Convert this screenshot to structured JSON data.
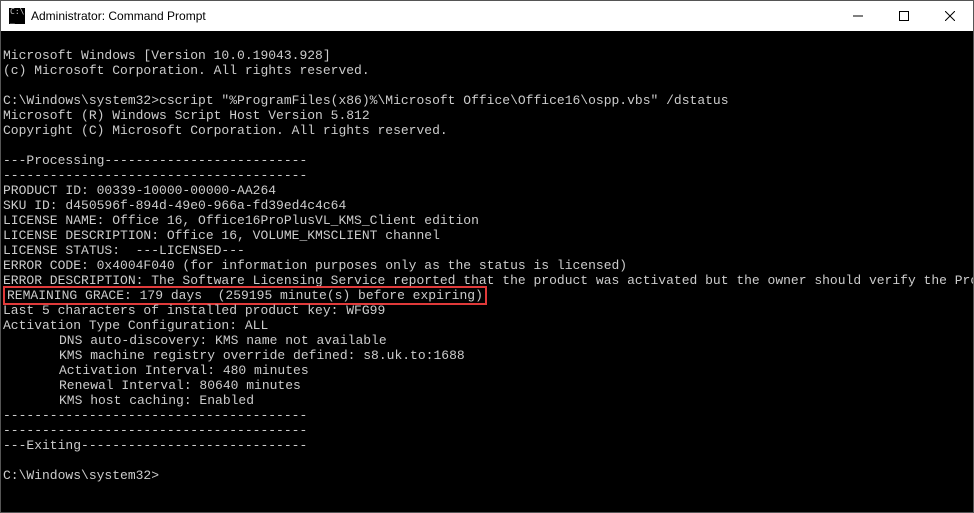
{
  "window": {
    "title": "Administrator: Command Prompt"
  },
  "terminal": {
    "header1": "Microsoft Windows [Version 10.0.19043.928]",
    "header2": "(c) Microsoft Corporation. All rights reserved.",
    "prompt1": "C:\\Windows\\system32>cscript \"%ProgramFiles(x86)%\\Microsoft Office\\Office16\\ospp.vbs\" /dstatus",
    "scripthost1": "Microsoft (R) Windows Script Host Version 5.812",
    "scripthost2": "Copyright (C) Microsoft Corporation. All rights reserved.",
    "processing": "---Processing--------------------------",
    "sep": "---------------------------------------",
    "product_id": "PRODUCT ID: 00339-10000-00000-AA264",
    "sku_id": "SKU ID: d450596f-894d-49e0-966a-fd39ed4c4c64",
    "license_name": "LICENSE NAME: Office 16, Office16ProPlusVL_KMS_Client edition",
    "license_desc": "LICENSE DESCRIPTION: Office 16, VOLUME_KMSCLIENT channel",
    "license_status": "LICENSE STATUS:  ---LICENSED---",
    "error_code": "ERROR CODE: 0x4004F040 (for information purposes only as the status is licensed)",
    "error_desc": "ERROR DESCRIPTION: The Software Licensing Service reported that the product was activated but the owner should verify the Product Use Rights.",
    "remaining_grace": "REMAINING GRACE: 179 days  (259195 minute(s) before expiring)",
    "last5": "Last 5 characters of installed product key: WFG99",
    "activation_type": "Activation Type Configuration: ALL",
    "dns": "DNS auto-discovery: KMS name not available",
    "kms_machine": "KMS machine registry override defined: s8.uk.to:1688",
    "activation_interval": "Activation Interval: 480 minutes",
    "renewal_interval": "Renewal Interval: 80640 minutes",
    "kms_cache": "KMS host caching: Enabled",
    "exiting": "---Exiting-----------------------------",
    "prompt2": "C:\\Windows\\system32>"
  }
}
